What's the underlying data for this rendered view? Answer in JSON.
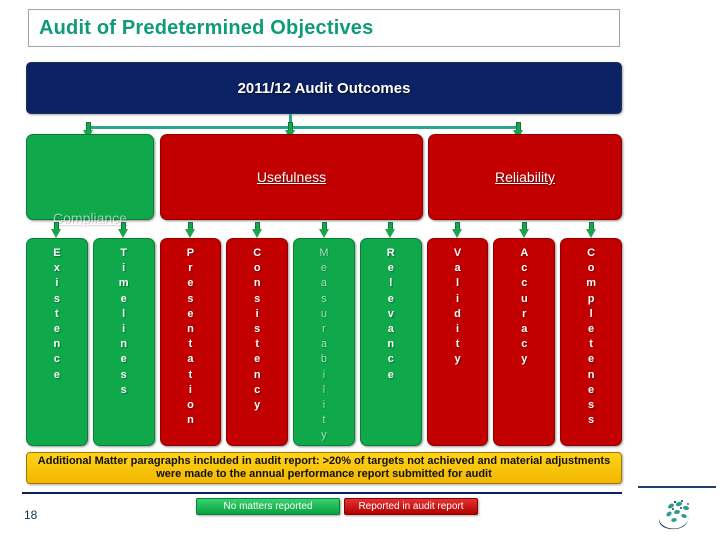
{
  "slide": {
    "title": "Audit of Predetermined Objectives",
    "page_number": "18",
    "header_box": "2011/12 Audit Outcomes"
  },
  "categories": [
    {
      "label": "Compliance",
      "status": "green",
      "label_style": "faded"
    },
    {
      "label": "Usefulness",
      "status": "red",
      "label_style": "normal"
    },
    {
      "label": "Reliability",
      "status": "red",
      "label_style": "normal"
    }
  ],
  "criteria": [
    {
      "label": "Existence",
      "status": "green",
      "faded": false
    },
    {
      "label": "Timeliness",
      "status": "green",
      "faded": false
    },
    {
      "label": "Presentation",
      "status": "red",
      "faded": false
    },
    {
      "label": "Consistency",
      "status": "red",
      "faded": false
    },
    {
      "label": "Measurability",
      "status": "green",
      "faded": true
    },
    {
      "label": "Relevance",
      "status": "green",
      "faded": false
    },
    {
      "label": "Validity",
      "status": "red",
      "faded": false
    },
    {
      "label": "Accuracy",
      "status": "red",
      "faded": false
    },
    {
      "label": "Completeness",
      "status": "red",
      "faded": false
    }
  ],
  "banner": {
    "text": "Additional Matter paragraphs included in audit report: >20% of targets not achieved and material adjustments were made to the annual performance report submitted for audit"
  },
  "legend": [
    {
      "label": "No matters reported",
      "status": "green"
    },
    {
      "label": "Reported in audit report",
      "status": "red"
    }
  ],
  "colors": {
    "title_text": "#0f9b78",
    "header_bg": "#0b2265",
    "green": "#0fa84a",
    "red": "#c20000",
    "banner": "#f2b700",
    "connector": "#2aa78a"
  },
  "photo_strip": [
    {
      "name": "flag-red-green-photo"
    },
    {
      "name": "people-green-photo"
    },
    {
      "name": "children-blue-photo"
    },
    {
      "name": "flag-green-yellow-photo"
    },
    {
      "name": "blue-mountain-photo"
    },
    {
      "name": "flag-yellow-green-photo"
    }
  ],
  "logo": {
    "name": "organisation-logo"
  }
}
